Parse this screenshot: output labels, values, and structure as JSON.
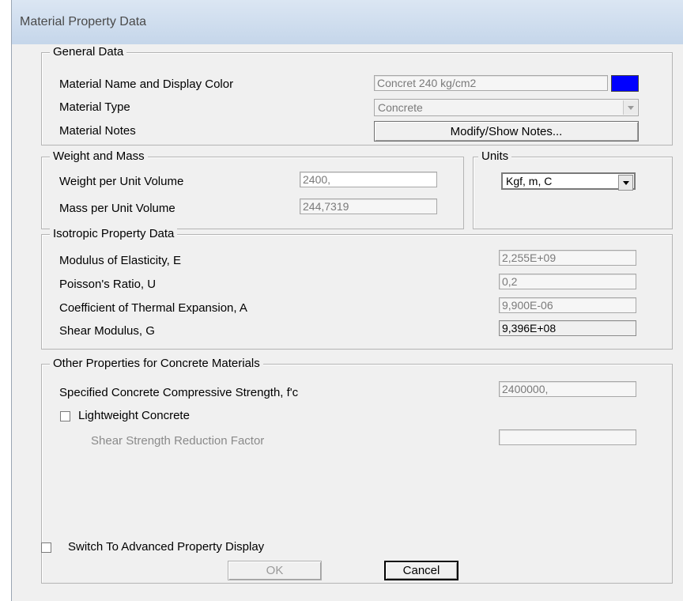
{
  "title": "Material Property Data",
  "general": {
    "legend": "General Data",
    "name_label": "Material Name and Display Color",
    "name_value": "Concret 240 kg/cm2",
    "display_color": "#0000ff",
    "type_label": "Material Type",
    "type_value": "Concrete",
    "notes_label": "Material Notes",
    "notes_button": "Modify/Show Notes..."
  },
  "weight": {
    "legend": "Weight and Mass",
    "weight_label": "Weight per Unit Volume",
    "weight_value": "2400,",
    "mass_label": "Mass per Unit Volume",
    "mass_value": "244,7319"
  },
  "units": {
    "legend": "Units",
    "value": "Kgf, m, C"
  },
  "isotropic": {
    "legend": "Isotropic Property Data",
    "e_label": "Modulus of Elasticity,  E",
    "e_value": "2,255E+09",
    "u_label": "Poisson's Ratio,  U",
    "u_value": "0,2",
    "a_label": "Coefficient of Thermal Expansion,  A",
    "a_value": "9,900E-06",
    "g_label": "Shear Modulus,  G",
    "g_value": "9,396E+08"
  },
  "concrete": {
    "legend": "Other Properties for Concrete Materials",
    "fc_label": "Specified Concrete Compressive Strength, f'c",
    "fc_value": "2400000,",
    "lightweight_label": "Lightweight Concrete",
    "lightweight_checked": false,
    "ssrf_label": "Shear Strength Reduction Factor",
    "ssrf_value": ""
  },
  "advanced_label": "Switch To Advanced Property Display",
  "advanced_checked": false,
  "ok_label": "OK",
  "cancel_label": "Cancel"
}
